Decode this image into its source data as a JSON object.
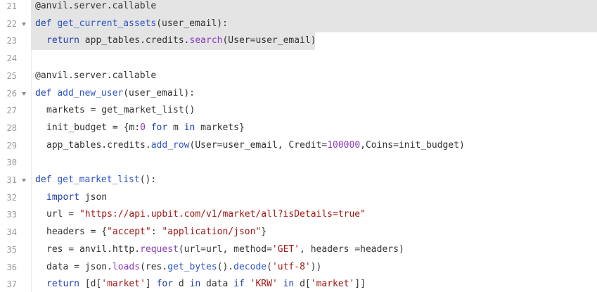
{
  "editor": {
    "lines": [
      {
        "n": "21",
        "tokens": [
          {
            "t": "@anvil.server.callable",
            "c": "plain"
          }
        ],
        "hl": true
      },
      {
        "n": "22",
        "fold": true,
        "hl": true,
        "tokens": [
          {
            "t": "def ",
            "c": "kw"
          },
          {
            "t": "get_current_assets",
            "c": "fn"
          },
          {
            "t": "(user_email):",
            "c": "plain"
          }
        ]
      },
      {
        "n": "23",
        "indent": 1,
        "hl": true,
        "tokens": [
          {
            "t": "return ",
            "c": "kw"
          },
          {
            "t": "app_tables.credits.",
            "c": "plain"
          },
          {
            "t": "search",
            "c": "call"
          },
          {
            "t": "(User=user_email)",
            "c": "plain"
          }
        ]
      },
      {
        "n": "24",
        "tokens": []
      },
      {
        "n": "25",
        "tokens": [
          {
            "t": "@anvil.server.callable",
            "c": "plain"
          }
        ]
      },
      {
        "n": "26",
        "fold": true,
        "tokens": [
          {
            "t": "def ",
            "c": "kw"
          },
          {
            "t": "add_new_user",
            "c": "fn"
          },
          {
            "t": "(user_email):",
            "c": "plain"
          }
        ]
      },
      {
        "n": "27",
        "indent": 1,
        "tokens": [
          {
            "t": "markets = get_market_list()",
            "c": "plain"
          }
        ]
      },
      {
        "n": "28",
        "indent": 1,
        "tokens": [
          {
            "t": "init_budget = {m:",
            "c": "plain"
          },
          {
            "t": "0",
            "c": "num"
          },
          {
            "t": " ",
            "c": "plain"
          },
          {
            "t": "for",
            "c": "kw"
          },
          {
            "t": " m ",
            "c": "plain"
          },
          {
            "t": "in",
            "c": "kw"
          },
          {
            "t": " markets}",
            "c": "plain"
          }
        ]
      },
      {
        "n": "29",
        "indent": 1,
        "tokens": [
          {
            "t": "app_tables.credits.",
            "c": "plain"
          },
          {
            "t": "add_row",
            "c": "fn"
          },
          {
            "t": "(User=user_email, Credit=",
            "c": "plain"
          },
          {
            "t": "100000",
            "c": "num"
          },
          {
            "t": ",Coins=init_budget)",
            "c": "plain"
          }
        ]
      },
      {
        "n": "30",
        "tokens": []
      },
      {
        "n": "31",
        "fold": true,
        "tokens": [
          {
            "t": "def ",
            "c": "kw"
          },
          {
            "t": "get_market_list",
            "c": "fn"
          },
          {
            "t": "():",
            "c": "plain"
          }
        ]
      },
      {
        "n": "32",
        "indent": 1,
        "tokens": [
          {
            "t": "import",
            "c": "kw"
          },
          {
            "t": " json",
            "c": "plain"
          }
        ]
      },
      {
        "n": "33",
        "indent": 1,
        "tokens": [
          {
            "t": "url = ",
            "c": "plain"
          },
          {
            "t": "\"https://api.upbit.com/v1/market/all?isDetails=true\"",
            "c": "str"
          }
        ]
      },
      {
        "n": "34",
        "indent": 1,
        "tokens": [
          {
            "t": "headers = {",
            "c": "plain"
          },
          {
            "t": "\"accept\"",
            "c": "str"
          },
          {
            "t": ": ",
            "c": "plain"
          },
          {
            "t": "\"application/json\"",
            "c": "str"
          },
          {
            "t": "}",
            "c": "plain"
          }
        ]
      },
      {
        "n": "35",
        "indent": 1,
        "tokens": [
          {
            "t": "res = anvil.http.",
            "c": "plain"
          },
          {
            "t": "request",
            "c": "call"
          },
          {
            "t": "(url=url, method=",
            "c": "plain"
          },
          {
            "t": "'GET'",
            "c": "str"
          },
          {
            "t": ", headers =headers)",
            "c": "plain"
          }
        ]
      },
      {
        "n": "36",
        "indent": 1,
        "tokens": [
          {
            "t": "data = json.",
            "c": "plain"
          },
          {
            "t": "loads",
            "c": "call"
          },
          {
            "t": "(res.",
            "c": "plain"
          },
          {
            "t": "get_bytes",
            "c": "fn"
          },
          {
            "t": "().",
            "c": "plain"
          },
          {
            "t": "decode",
            "c": "fn"
          },
          {
            "t": "(",
            "c": "plain"
          },
          {
            "t": "'utf-8'",
            "c": "str"
          },
          {
            "t": "))",
            "c": "plain"
          }
        ]
      },
      {
        "n": "37",
        "indent": 1,
        "tokens": [
          {
            "t": "return",
            "c": "kw"
          },
          {
            "t": " [d[",
            "c": "plain"
          },
          {
            "t": "'market'",
            "c": "str"
          },
          {
            "t": "] ",
            "c": "plain"
          },
          {
            "t": "for",
            "c": "kw"
          },
          {
            "t": " d ",
            "c": "plain"
          },
          {
            "t": "in",
            "c": "kw"
          },
          {
            "t": " data ",
            "c": "plain"
          },
          {
            "t": "if",
            "c": "kw"
          },
          {
            "t": " ",
            "c": "plain"
          },
          {
            "t": "'KRW'",
            "c": "str"
          },
          {
            "t": " ",
            "c": "plain"
          },
          {
            "t": "in",
            "c": "kw"
          },
          {
            "t": " d[",
            "c": "plain"
          },
          {
            "t": "'market'",
            "c": "str"
          },
          {
            "t": "]]",
            "c": "plain"
          }
        ]
      }
    ]
  }
}
